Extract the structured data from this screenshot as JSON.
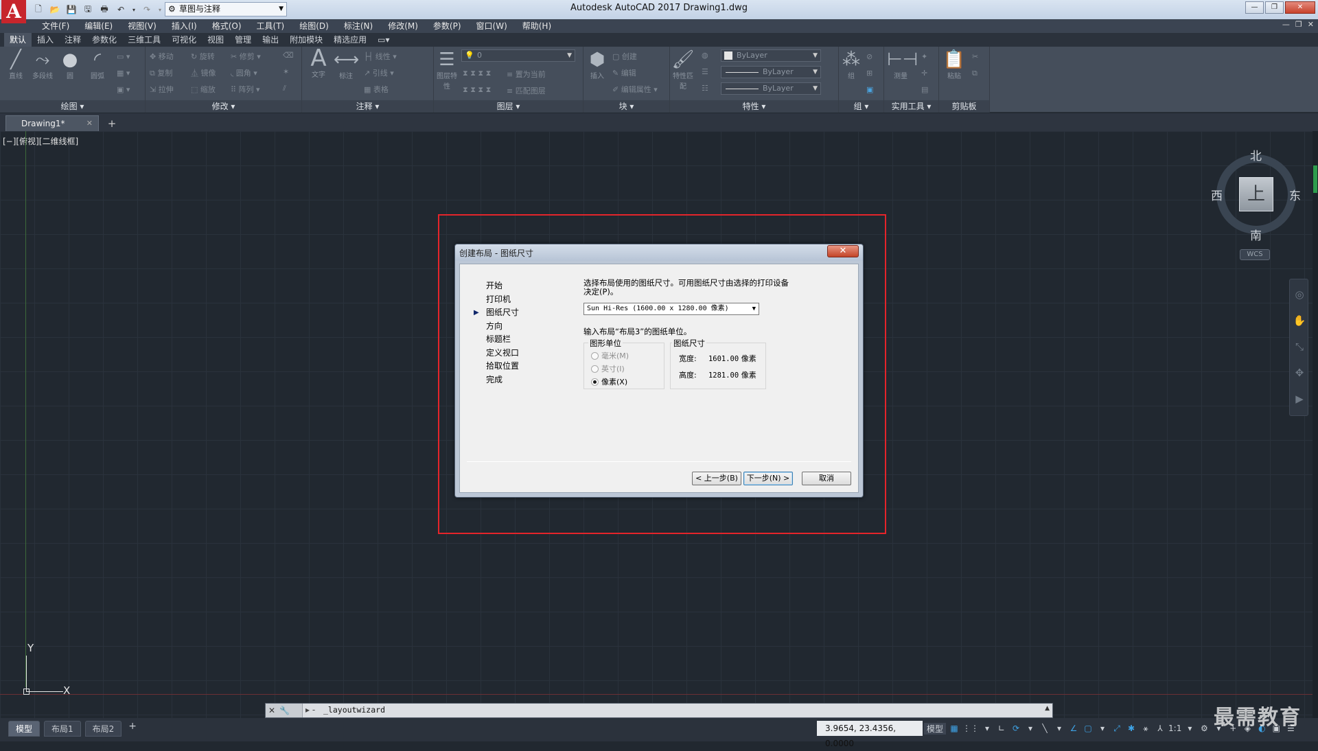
{
  "titlebar": {
    "app_logo": "A",
    "workspace": "草图与注释",
    "title": "Autodesk AutoCAD 2017    Drawing1.dwg",
    "min": "—",
    "max": "❐",
    "close": "✕"
  },
  "menu": [
    "文件(F)",
    "编辑(E)",
    "视图(V)",
    "插入(I)",
    "格式(O)",
    "工具(T)",
    "绘图(D)",
    "标注(N)",
    "修改(M)",
    "参数(P)",
    "窗口(W)",
    "帮助(H)"
  ],
  "ribbon_tabs": [
    "默认",
    "插入",
    "注释",
    "参数化",
    "三维工具",
    "可视化",
    "视图",
    "管理",
    "输出",
    "附加模块",
    "精选应用"
  ],
  "ribbon": {
    "draw": {
      "title": "绘图",
      "tools": [
        "直线",
        "多段线",
        "圆",
        "圆弧"
      ]
    },
    "modify": {
      "title": "修改",
      "tools": [
        "移动",
        "旋转",
        "修剪",
        "复制",
        "镜像",
        "圆角",
        "拉伸",
        "缩放",
        "阵列"
      ]
    },
    "annotation": {
      "title": "注释",
      "tools": [
        "文字",
        "标注",
        "线性",
        "引线",
        "表格"
      ]
    },
    "layers": {
      "title": "图层",
      "layer_value": "0",
      "tools": [
        "图层特性",
        "置为当前",
        "匹配图层"
      ]
    },
    "block": {
      "title": "块",
      "tools": [
        "插入",
        "创建",
        "编辑",
        "编辑属性"
      ]
    },
    "properties": {
      "title": "特性",
      "color": "ByLayer",
      "linetype": "ByLayer",
      "lineweight": "ByLayer",
      "tools": [
        "特性匹配"
      ]
    },
    "groups": {
      "title": "组",
      "tools": [
        "组"
      ]
    },
    "utilities": {
      "title": "实用工具",
      "tools": [
        "测量"
      ]
    },
    "clipboard": {
      "title": "剪贴板",
      "tools": [
        "粘贴"
      ]
    }
  },
  "file_tab": {
    "name": "Drawing1*",
    "close": "✕",
    "new": "+"
  },
  "canvas": {
    "viewport_label": "[−][俯视][二维线框]",
    "ucs_x": "X",
    "ucs_y": "Y",
    "viewcube": {
      "top": "上",
      "north": "北",
      "south": "南",
      "east": "东",
      "west": "西",
      "wcs": "WCS"
    }
  },
  "dialog": {
    "title": "创建布局 - 图纸尺寸",
    "close": "✕",
    "steps": [
      "开始",
      "打印机",
      "图纸尺寸",
      "方向",
      "标题栏",
      "定义视口",
      "拾取位置",
      "完成"
    ],
    "current_step_index": 2,
    "description": "选择布局使用的图纸尺寸。可用图纸尺寸由选择的打印设备决定(P)。",
    "paper_size_value": "Sun Hi-Res (1600.00 x 1280.00 像素)",
    "layout_note": "输入布局“布局3”的图纸单位。",
    "units_label": "图形单位",
    "unit_mm": "毫米(M)",
    "unit_inch": "英寸(I)",
    "unit_px": "像素(X)",
    "selected_unit": "像素(X)",
    "size_label": "图纸尺寸",
    "width_label": "宽度:",
    "width_value": "1601.00",
    "width_unit": "像素",
    "height_label": "高度:",
    "height_value": "1281.00",
    "height_unit": "像素",
    "back_button": "< 上一步(B)",
    "next_button": "下一步(N) >",
    "cancel_button": "取消"
  },
  "command_line": {
    "prompt": "▸ -",
    "text": "_layoutwizard"
  },
  "status": {
    "layout_tabs": [
      "模型",
      "布局1",
      "布局2"
    ],
    "add_tab": "+",
    "coords": "3.9654, 23.4356, 0.0000",
    "model_label": "模型",
    "scale": "1:1"
  },
  "watermark": "最需教育"
}
